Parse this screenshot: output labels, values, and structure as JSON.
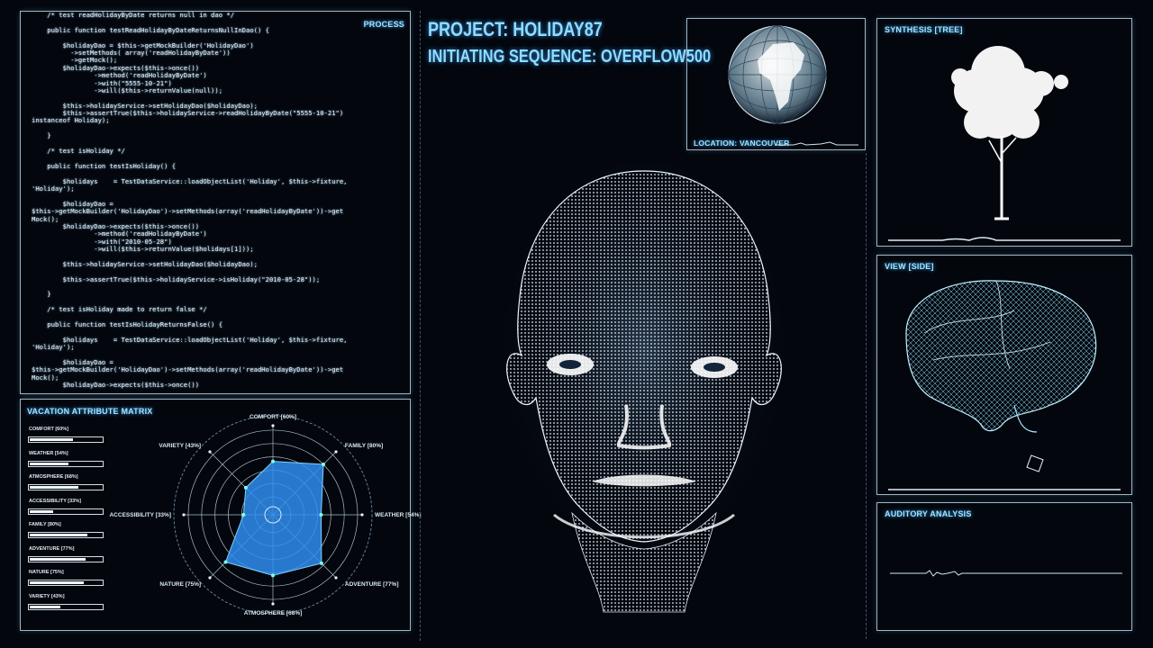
{
  "process_panel": {
    "title": "PROCESS",
    "code_lines": [
      "    /* test readHolidayByDate returns null in dao */",
      "",
      "    public function testReadHolidayByDateReturnsNullInDao() {",
      "",
      "        $holidayDao = $this->getMockBuilder('HolidayDao')",
      "          ->setMethods( array('readHolidayByDate'))",
      "          ->getMock();",
      "        $holidayDao->expects($this->once())",
      "                ->method('readHolidayByDate')",
      "                ->with(\"5555-10-21\")",
      "                ->will($this->returnValue(null));",
      "",
      "        $this->holidayService->setHolidayDao($holidayDao);",
      "        $this->assertTrue($this->holidayService->readHolidayByDate(\"5555-10-21\")",
      "instanceof Holiday);",
      "",
      "    }",
      "",
      "    /* test isHoliday */",
      "",
      "    public function testIsHoliday() {",
      "",
      "        $holidays    = TestDataService::loadObjectList('Holiday', $this->fixture,",
      "'Holiday');",
      "",
      "        $holidayDao =",
      "$this->getMockBuilder('HolidayDao')->setMethods(array('readHolidayByDate'))->get",
      "Mock();",
      "        $holidayDao->expects($this->once())",
      "                ->method('readHolidayByDate')",
      "                ->with(\"2010-05-28\")",
      "                ->will($this->returnValue($holidays[1]));",
      "",
      "        $this->holidayService->setHolidayDao($holidayDao);",
      "",
      "        $this->assertTrue($this->holidayService->isHoliday(\"2010-05-28\"));",
      "",
      "    }",
      "",
      "    /* test isHoliday made to return false */",
      "",
      "    public function testIsHolidayReturnsFalse() {",
      "",
      "        $holidays    = TestDataService::loadObjectList('Holiday', $this->fixture,",
      "'Holiday');",
      "",
      "        $holidayDao =",
      "$this->getMockBuilder('HolidayDao')->setMethods(array('readHolidayByDate'))->get",
      "Mock();",
      "        $holidayDao->expects($this->once())"
    ]
  },
  "header": {
    "project": "PROJECT: HOLIDAY87",
    "sequence": "INITIATING SEQUENCE: OVERFLOW500"
  },
  "globe_panel": {
    "location": "LOCATION: VANCOUVER"
  },
  "synthesis_panel": {
    "title": "SYNTHESIS [TREE]"
  },
  "view_panel": {
    "title": "VIEW [SIDE]"
  },
  "auditory_panel": {
    "title": "AUDITORY ANALYSIS"
  },
  "matrix_panel": {
    "title": "VACATION ATTRIBUTE MATRIX",
    "attributes": [
      {
        "label": "COMFORT [60%]",
        "value": 0.6
      },
      {
        "label": "WEATHER [54%]",
        "value": 0.54
      },
      {
        "label": "ATMOSPHERE [68%]",
        "value": 0.68
      },
      {
        "label": "ACCESSIBILITY [33%]",
        "value": 0.33
      },
      {
        "label": "FAMILY [80%]",
        "value": 0.8
      },
      {
        "label": "ADVENTURE [77%]",
        "value": 0.77
      },
      {
        "label": "NATURE [75%]",
        "value": 0.75
      },
      {
        "label": "VARIETY [43%]",
        "value": 0.43
      }
    ],
    "radar": [
      {
        "label": "COMFORT [60%]",
        "value": 0.6
      },
      {
        "label": "FAMILY [80%]",
        "value": 0.8
      },
      {
        "label": "WEATHER [54%]",
        "value": 0.54
      },
      {
        "label": "ADVENTURE [77%]",
        "value": 0.77
      },
      {
        "label": "ATMOSPHERE [68%]",
        "value": 0.68
      },
      {
        "label": "NATURE [75%]",
        "value": 0.75
      },
      {
        "label": "ACCESSIBILITY [33%]",
        "value": 0.33
      },
      {
        "label": "VARIETY [43%]",
        "value": 0.43
      }
    ]
  },
  "colors": {
    "accent": "#8fdcff",
    "radar_fill": "#2f8ef0",
    "border": "#9fb6c6"
  }
}
